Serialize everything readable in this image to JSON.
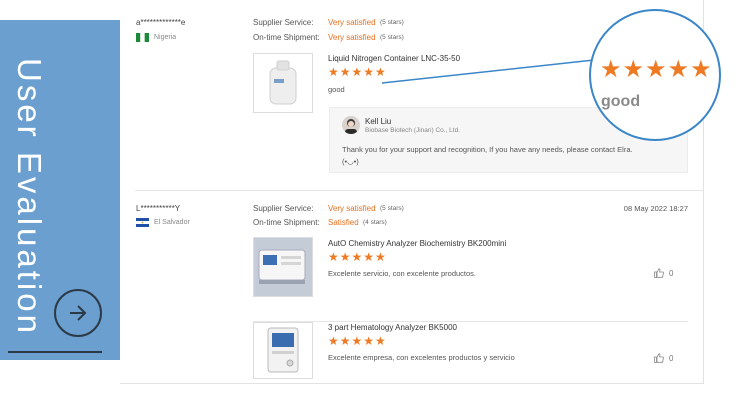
{
  "side_panel": {
    "title": "User Evaluation",
    "arrow_icon": "arrow-right-icon",
    "bg_color": "#6a9fd0"
  },
  "labels": {
    "supplier_service": "Supplier Service:",
    "on_time_shipment": "On-time Shipment:"
  },
  "reviews": [
    {
      "user": "a*************e",
      "country": "Nigeria",
      "supplier_service": "Very satisfied",
      "supplier_stars": "(5 stars)",
      "on_time_shipment": "Very satisfied",
      "shipment_stars": "(5 stars)",
      "date": "",
      "product": {
        "name": "Liquid Nitrogen Container LNC-35-50",
        "rating": 5,
        "comment": "good"
      },
      "reply": {
        "name": "Kell Liu",
        "company": "Biobase Biotech (Jinan) Co., Ltd.",
        "text": "Thank you for your support and recognition,  If you have any needs, please contact Elra.",
        "emoticon": "(•◡•)"
      }
    },
    {
      "user": "L***********Y",
      "country": "El Salvador",
      "supplier_service": "Very satisfied",
      "supplier_stars": "(5 stars)",
      "on_time_shipment": "Satisfied",
      "shipment_stars": "(4 stars)",
      "date": "08 May 2022 18:27",
      "products": [
        {
          "name": "AutO Chemistry Analyzer Biochemistry BK200mini",
          "rating": 5,
          "comment": "Excelente servicio, con excelente productos.",
          "likes": "0"
        },
        {
          "name": "3 part Hematology Analyzer BK5000",
          "rating": 5,
          "comment": "Excelente empresa, con excelentes productos y servicio",
          "likes": "0"
        }
      ]
    }
  ],
  "zoom": {
    "stars": "★★★★★",
    "text": "good"
  },
  "star_glyphs": "★★★★★",
  "colors": {
    "accent": "#ee7a23",
    "satisfied": "#e8701e",
    "zoom_border": "#3a86c8"
  }
}
